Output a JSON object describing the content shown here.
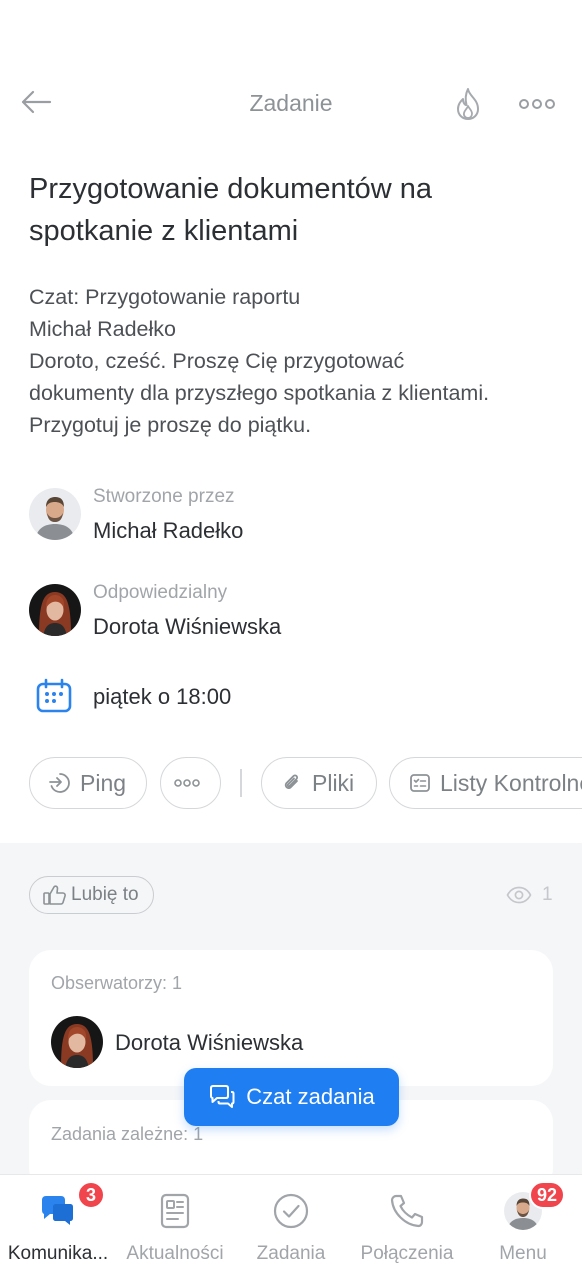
{
  "header": {
    "title": "Zadanie"
  },
  "task": {
    "title": "Przygotowanie dokumentów na spotkanie z klientami",
    "description_lines": [
      "Czat: Przygotowanie raportu",
      "Michał Radełko",
      "Doroto, cześć. Proszę Cię przygotować",
      "dokumenty dla przyszłego spotkania z klientami.",
      "Przygotuj je proszę do piątku."
    ]
  },
  "creator": {
    "label": "Stworzone przez",
    "name": "Michał Radełko"
  },
  "responsible": {
    "label": "Odpowiedzialny",
    "name": "Dorota Wiśniewska"
  },
  "deadline": {
    "text": "piątek o 18:00"
  },
  "actions": {
    "ping": "Ping",
    "files": "Pliki",
    "checklists": "Listy Kontrolne"
  },
  "likes": {
    "label": "Lubię to",
    "views": "1"
  },
  "observers": {
    "label": "Obserwatorzy: 1",
    "name": "Dorota Wiśniewska"
  },
  "dependent": {
    "label": "Zadania zależne: 1"
  },
  "chat_button": {
    "label": "Czat zadania"
  },
  "nav": {
    "items": [
      {
        "label": "Komunika...",
        "badge": "3"
      },
      {
        "label": "Aktualności"
      },
      {
        "label": "Zadania"
      },
      {
        "label": "Połączenia"
      },
      {
        "label": "Menu",
        "badge": "92"
      }
    ]
  },
  "colors": {
    "accent": "#1f7ff2",
    "badge": "#f0454c",
    "muted": "#a1a5a9"
  }
}
